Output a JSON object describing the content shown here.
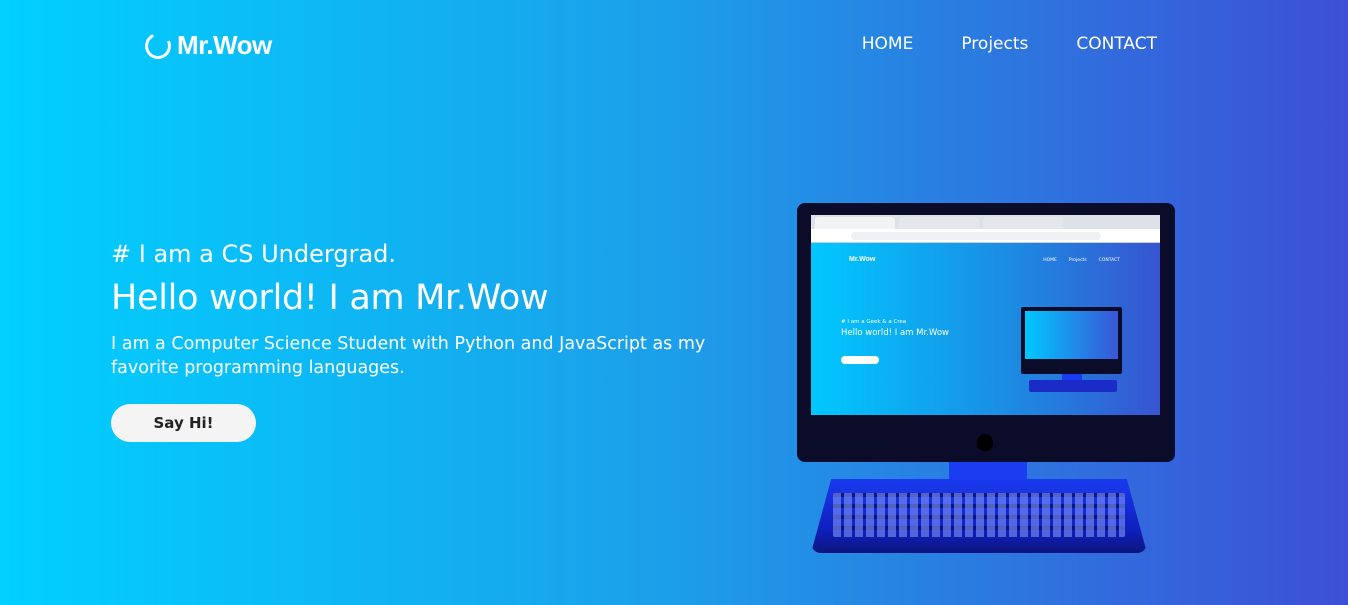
{
  "brand": {
    "name": "Mr.Wow",
    "icon": "ring-icon"
  },
  "nav": {
    "items": [
      {
        "label": "HOME"
      },
      {
        "label": "Projects"
      },
      {
        "label": "CONTACT"
      }
    ]
  },
  "hero": {
    "subtitle": "# I am a CS Undergrad.",
    "title": "Hello world! I am Mr.Wow",
    "description": "I am a Computer Science Student with Python and JavaScript as my favorite programming languages.",
    "button_label": "Say Hi!"
  },
  "illustration": {
    "screen": {
      "logo": "Mr.Wow",
      "nav": [
        "HOME",
        "Projects",
        "CONTACT"
      ],
      "subtitle": "# I am a Geek & a Crea",
      "title": "Hello world! I am Mr.Wow"
    }
  },
  "colors": {
    "gradient_start": "#00d0ff",
    "gradient_end": "#3d4fd6",
    "button_bg": "#f4f4f4",
    "text": "#ffffff"
  }
}
